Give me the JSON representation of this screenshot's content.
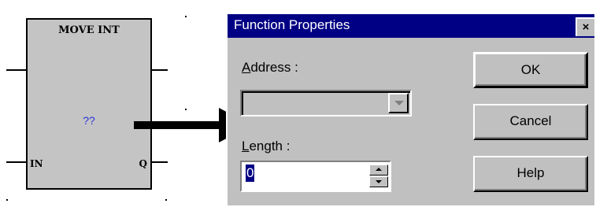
{
  "function_block": {
    "title": "MOVE INT",
    "parameter": "??",
    "input_label": "IN",
    "output_label": "Q",
    "param_color": "#2a36d9"
  },
  "dialog": {
    "title": "Function Properties",
    "close_label": "×",
    "address": {
      "label_access_key": "A",
      "label_rest": "ddress :",
      "value": ""
    },
    "length": {
      "label_access_key": "L",
      "label_rest": "ength :",
      "value": "0"
    },
    "buttons": {
      "ok": "OK",
      "cancel": "Cancel",
      "help": "Help"
    },
    "colors": {
      "titlebar": "#000084",
      "face": "#c0c0c0"
    }
  }
}
